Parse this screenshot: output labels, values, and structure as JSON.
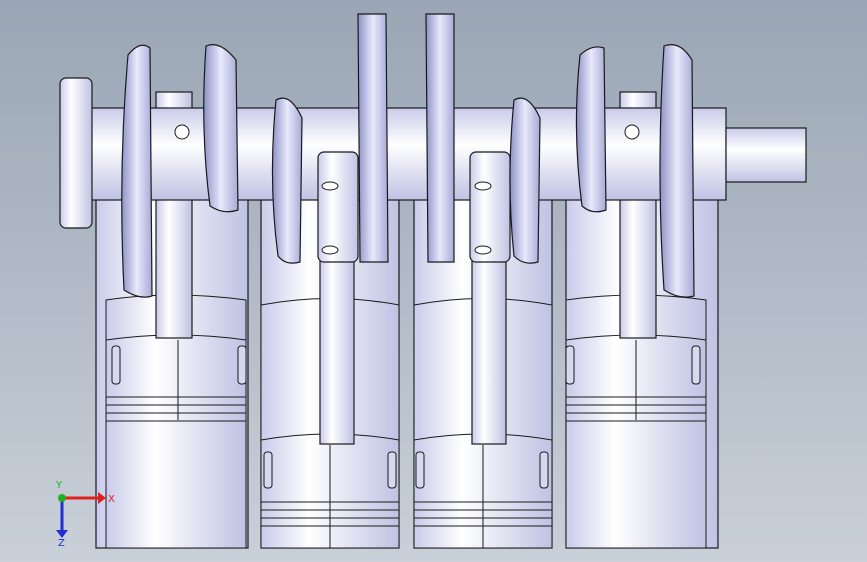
{
  "viewport": {
    "background_top": "#9aa6b5",
    "background_bottom": "#c9d0d9",
    "part_fill": "#eef0ff",
    "part_shade": "#c8cbe6",
    "edge_color": "#1a1a1a"
  },
  "model": {
    "description_icon": "crankshaft-piston-assembly",
    "cylinder_count": 4
  },
  "triad": {
    "x_label": "X",
    "y_label": "Y",
    "z_label": "Z",
    "x_color": "#e02020",
    "y_color": "#20b020",
    "z_color": "#2030d0"
  }
}
